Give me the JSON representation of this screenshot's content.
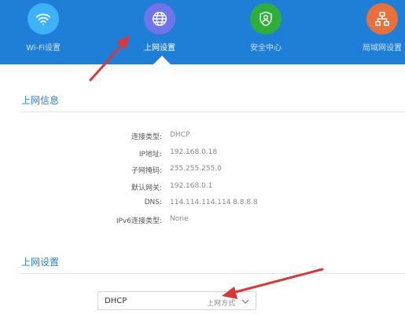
{
  "nav": {
    "items": [
      {
        "label": "Wi-Fi设置",
        "icon": "wifi-icon",
        "color": "#3db3f5"
      },
      {
        "label": "上网设置",
        "icon": "globe-icon",
        "color": "#6f74e8"
      },
      {
        "label": "安全中心",
        "icon": "shield-user-icon",
        "color": "#2fae3b"
      },
      {
        "label": "局域网设置",
        "icon": "network-icon",
        "color": "#e8703c"
      }
    ],
    "active": "上网设置",
    "bar_color": "#1f7fd7"
  },
  "internet_info": {
    "title": "上网信息",
    "rows": [
      {
        "label": "连接类型:",
        "value": "DHCP"
      },
      {
        "label": "IP地址:",
        "value": "192.168.0.18"
      },
      {
        "label": "子网掩码:",
        "value": "255.255.255.0"
      },
      {
        "label": "默认网关:",
        "value": "192.168.0.1"
      },
      {
        "label": "DNS:",
        "value": "114.114.114.114 8.8.8.8"
      },
      {
        "label": "IPv6连接类型:",
        "value": "None"
      }
    ]
  },
  "internet_settings": {
    "title": "上网设置",
    "select_value": "DHCP",
    "select_placeholder": "上网方式"
  },
  "annotation_color": "#d9383a"
}
